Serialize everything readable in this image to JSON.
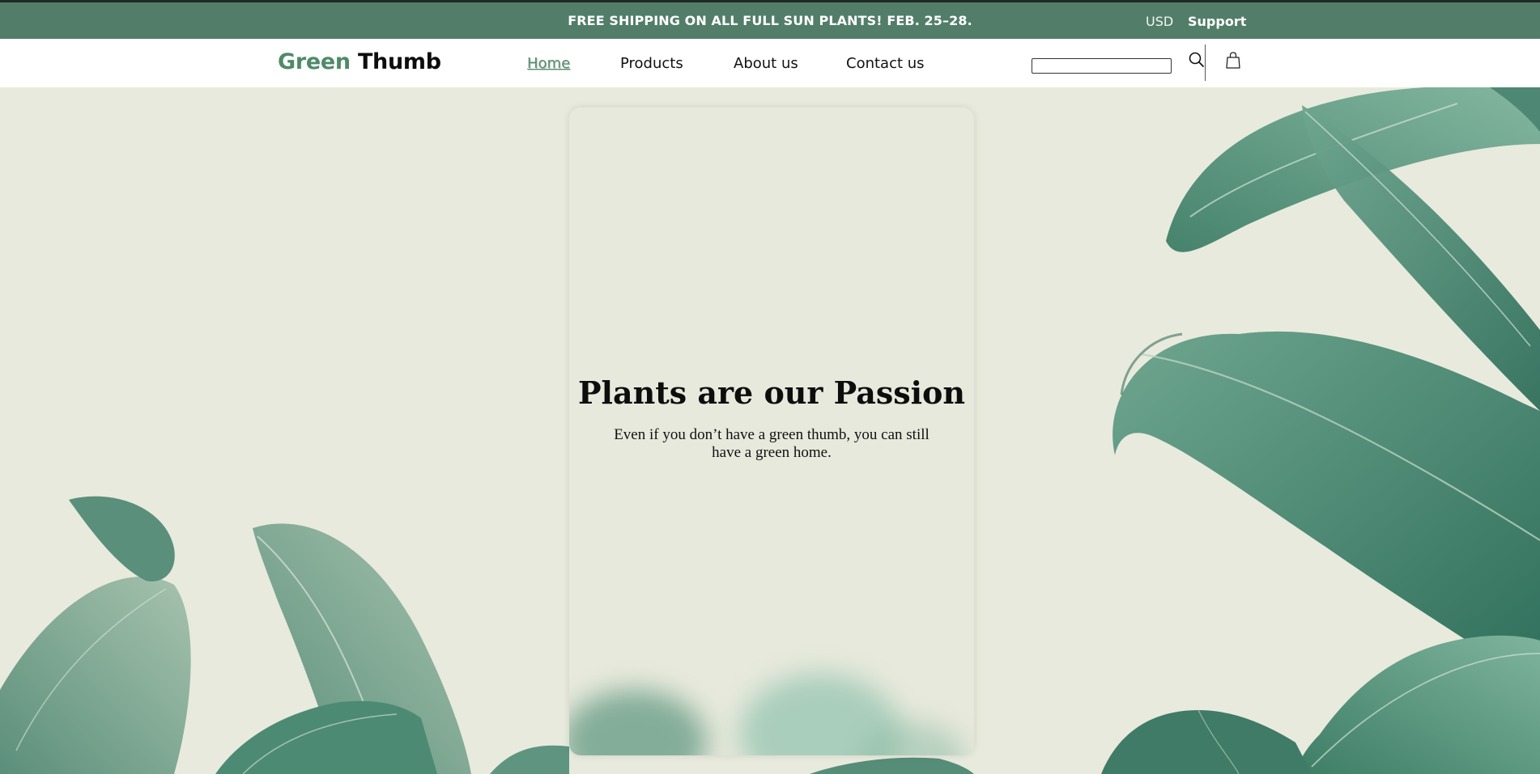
{
  "announcement": {
    "text": "FREE SHIPPING ON ALL FULL SUN PLANTS! FEB. 25–28.",
    "currency": "USD",
    "support": "Support"
  },
  "brand": {
    "green_part": "Green",
    "dark_part": "Thumb"
  },
  "nav": {
    "home": "Home",
    "products": "Products",
    "about": "About us",
    "contact": "Contact us"
  },
  "search": {
    "placeholder": "",
    "value": ""
  },
  "icons": {
    "search": "search-icon",
    "bag": "shopping-bag-icon"
  },
  "hero": {
    "title": "Plants are our Passion",
    "subtitle": "Even if you don’t have a green thumb, you can still have a green home."
  },
  "colors": {
    "accent": "#527e69",
    "brand_green": "#4f8a68",
    "background": "#e8eadd"
  }
}
